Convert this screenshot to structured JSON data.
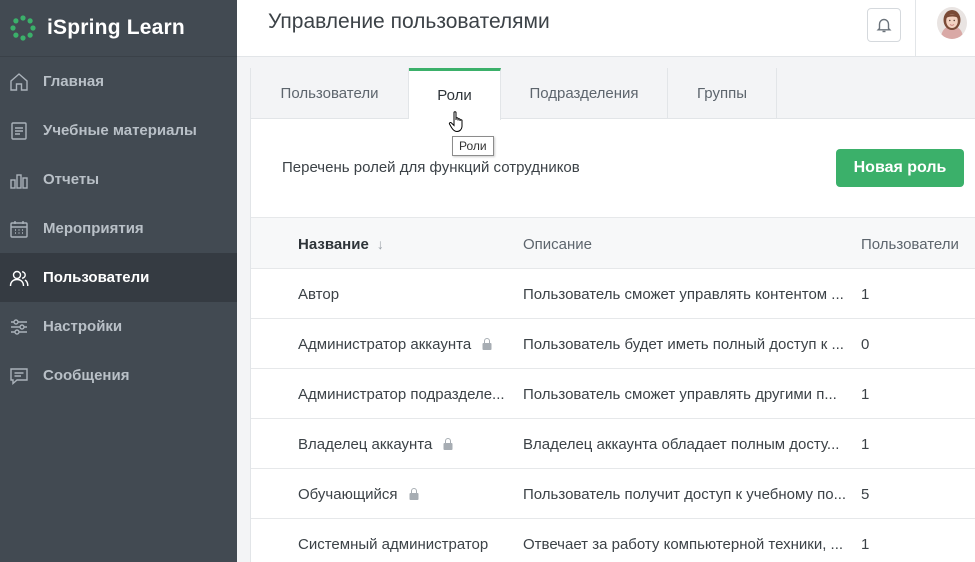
{
  "app": {
    "name": "iSpring Learn"
  },
  "sidebar": {
    "items": [
      {
        "label": "Главная",
        "icon": "home-icon"
      },
      {
        "label": "Учебные материалы",
        "icon": "materials-icon"
      },
      {
        "label": "Отчеты",
        "icon": "reports-icon"
      },
      {
        "label": "Мероприятия",
        "icon": "calendar-icon"
      },
      {
        "label": "Пользователи",
        "icon": "users-icon",
        "active": true
      },
      {
        "label": "Настройки",
        "icon": "settings-icon"
      },
      {
        "label": "Сообщения",
        "icon": "messages-icon"
      }
    ]
  },
  "header": {
    "title": "Управление пользователями"
  },
  "tabs": [
    {
      "label": "Пользователи"
    },
    {
      "label": "Роли",
      "active": true
    },
    {
      "label": "Подразделения"
    },
    {
      "label": "Группы"
    }
  ],
  "tooltip": {
    "text": "Роли"
  },
  "roles": {
    "description": "Перечень ролей для функций сотрудников",
    "new_button": "Новая роль",
    "columns": {
      "name": "Название",
      "description": "Описание",
      "users": "Пользователи"
    },
    "rows": [
      {
        "name": "Автор",
        "description": "Пользователь сможет управлять контентом ...",
        "users": "1",
        "locked": false
      },
      {
        "name": "Администратор аккаунта",
        "description": "Пользователь будет иметь полный доступ к ...",
        "users": "0",
        "locked": true
      },
      {
        "name": "Администратор подразделе...",
        "description": "Пользователь сможет управлять другими п...",
        "users": "1",
        "locked": false
      },
      {
        "name": "Владелец аккаунта",
        "description": "Владелец аккаунта обладает полным досту...",
        "users": "1",
        "locked": true
      },
      {
        "name": "Обучающийся",
        "description": "Пользователь получит доступ к учебному по...",
        "users": "5",
        "locked": true
      },
      {
        "name": "Системный администратор",
        "description": "Отвечает за работу компьютерной техники, ...",
        "users": "1",
        "locked": false
      }
    ]
  },
  "colors": {
    "accent": "#3bb06a",
    "sidebar": "#424a52",
    "sidebar_active": "#353b42"
  }
}
